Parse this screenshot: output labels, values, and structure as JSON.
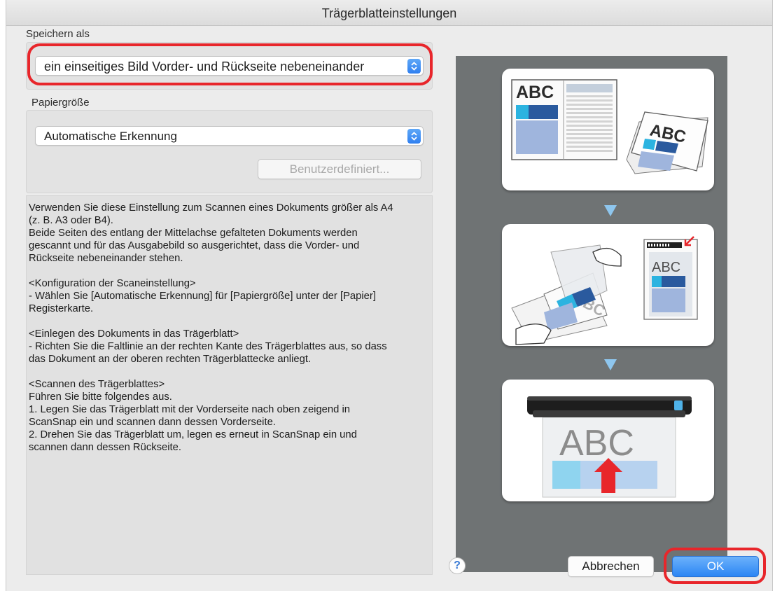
{
  "window": {
    "title": "Trägerblatteinstellungen"
  },
  "save_as": {
    "label": "Speichern als",
    "selected": "ein einseitiges Bild Vorder- und Rückseite nebeneinander"
  },
  "paper_size": {
    "label": "Papiergröße",
    "selected": "Automatische Erkennung",
    "custom_button": "Benutzerdefiniert..."
  },
  "description": {
    "text": "Verwenden Sie diese Einstellung zum Scannen eines Dokuments größer als A4\n(z. B. A3 oder B4).\nBeide Seiten des entlang der Mittelachse gefalteten Dokuments werden\ngescannt und für das Ausgabebild so ausgerichtet, dass die Vorder- und\nRückseite nebeneinander stehen.\n\n<Konfiguration der Scaneinstellung>\n- Wählen Sie [Automatische Erkennung] für [Papiergröße] unter der [Papier]\nRegisterkarte.\n\n<Einlegen des Dokuments in das Trägerblatt>\n- Richten Sie die Faltlinie an der rechten Kante des Trägerblattes aus, so dass\ndas Dokument an der oberen rechten Trägerblattecke anliegt.\n\n<Scannen des Trägerblattes>\nFühren Sie bitte folgendes aus.\n1. Legen Sie das Trägerblatt mit der Vorderseite nach oben zeigend in\nScanSnap ein und scannen dann dessen Vorderseite.\n2. Drehen Sie das Trägerblatt um, legen es erneut in ScanSnap ein und\nscannen dann dessen Rückseite."
  },
  "illustration": {
    "step1_text": "ABC",
    "step1_folded_text": "ABC",
    "step2_text": "ABC",
    "step2_carrier_text": "ABC",
    "step3_text": "ABC"
  },
  "footer": {
    "help_symbol": "?",
    "cancel_label": "Abbrechen",
    "ok_label": "OK"
  },
  "colors": {
    "highlight_ring": "#e8262b",
    "accent_blue": "#2f7ff0",
    "illustration_bg": "#6f7374"
  }
}
